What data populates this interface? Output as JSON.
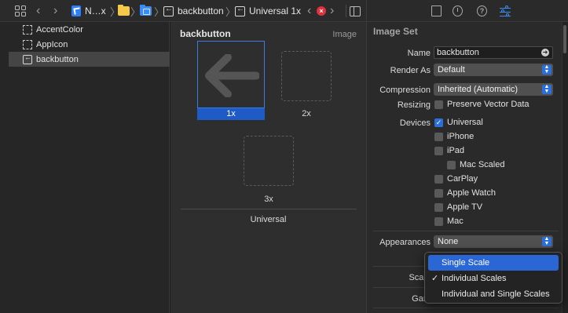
{
  "toolbar": {
    "breadcrumbs": [
      {
        "label": "N…x",
        "icon": "project-icon"
      },
      {
        "label": "",
        "icon": "folder-icon"
      },
      {
        "label": "",
        "icon": "asset-catalog-folder-icon"
      },
      {
        "label": "backbutton",
        "icon": "image-set-icon"
      },
      {
        "label": "Universal 1x",
        "icon": "image-set-icon"
      }
    ],
    "error_badge": "×"
  },
  "outline": {
    "items": [
      {
        "label": "AccentColor",
        "icon": "color-set-icon",
        "selected": false
      },
      {
        "label": "AppIcon",
        "icon": "app-icon-set-icon",
        "selected": false
      },
      {
        "label": "backbutton",
        "icon": "image-set-icon",
        "selected": true
      }
    ]
  },
  "canvas": {
    "title": "backbutton",
    "type_label": "Image",
    "slots": [
      {
        "label": "1x",
        "filled": true,
        "selected": true
      },
      {
        "label": "2x",
        "filled": false,
        "selected": false
      },
      {
        "label": "3x",
        "filled": false,
        "selected": false
      }
    ],
    "group_label": "Universal"
  },
  "inspector": {
    "section_title": "Image Set",
    "name_label": "Name",
    "name_value": "backbutton",
    "render_as_label": "Render As",
    "render_as_value": "Default",
    "compression_label": "Compression",
    "compression_value": "Inherited (Automatic)",
    "resizing_label": "Resizing",
    "preserve_vector_label": "Preserve Vector Data",
    "devices_label": "Devices",
    "devices": [
      {
        "label": "Universal",
        "checked": true
      },
      {
        "label": "iPhone",
        "checked": false
      },
      {
        "label": "iPad",
        "checked": false
      },
      {
        "label": "Mac Scaled",
        "checked": false
      },
      {
        "label": "CarPlay",
        "checked": false
      },
      {
        "label": "Apple Watch",
        "checked": false
      },
      {
        "label": "Apple TV",
        "checked": false
      },
      {
        "label": "Mac",
        "checked": false
      }
    ],
    "appearances_label": "Appearances",
    "appearances_value": "None",
    "scales_label": "Scale",
    "gamut_label": "Gam"
  },
  "scales_menu": {
    "options": [
      {
        "label": "Single Scale",
        "highlighted": true,
        "checked": false
      },
      {
        "label": "Individual Scales",
        "highlighted": false,
        "checked": true
      },
      {
        "label": "Individual and Single Scales",
        "highlighted": false,
        "checked": false
      }
    ]
  },
  "colors": {
    "accent": "#2d6fd8",
    "selection": "#1f5bc6",
    "error": "#e0323c"
  }
}
